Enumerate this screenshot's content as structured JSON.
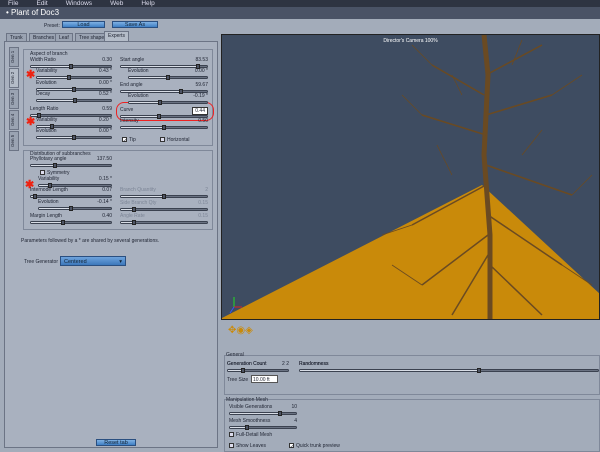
{
  "menu": [
    "File",
    "Edit",
    "Windows",
    "Web",
    "Help"
  ],
  "window_title": "Plant of Doc3",
  "preset": {
    "label": "Preset:",
    "load": "Load",
    "save_as": "Save As"
  },
  "tabs": [
    {
      "label": "Trunk"
    },
    {
      "label": "Branches"
    },
    {
      "label": "Leaf"
    },
    {
      "label": "Tree shape"
    },
    {
      "label": "Experts",
      "active": true
    }
  ],
  "generation_tabs": [
    "Gen 1",
    "Gen 2",
    "Gen 3",
    "Gen 4",
    "Gen 5"
  ],
  "aspect": {
    "title": "Aspect of branch",
    "left": [
      {
        "label": "Width Ratio",
        "value": "0.30",
        "fraction": 0.5
      },
      {
        "label": "Variability",
        "value": "0.43 *",
        "fraction": 0.43,
        "indent": true
      },
      {
        "label": "Evolution",
        "value": "0.00 *",
        "fraction": 0.5,
        "indent": true
      },
      {
        "label": "Decay",
        "value": "0.52 *",
        "fraction": 0.52,
        "indent": true
      },
      {
        "label": "Length Ratio",
        "value": "0.59",
        "fraction": 0.1
      },
      {
        "label": "Variability",
        "value": "0.20 *",
        "fraction": 0.2,
        "indent": true
      },
      {
        "label": "Evolution",
        "value": "0.00 *",
        "fraction": 0.5,
        "indent": true
      }
    ],
    "right": [
      {
        "label": "Start angle",
        "value": "83.53",
        "fraction": 0.9
      },
      {
        "label": "Evolution",
        "value": "0.00 *",
        "fraction": 0.5,
        "indent": true
      },
      {
        "label": "End angle",
        "value": "59.67",
        "fraction": 0.7
      },
      {
        "label": "Evolution",
        "value": "-0.19 *",
        "fraction": 0.4,
        "indent": true
      },
      {
        "label": "Curve",
        "value": "0.44",
        "fraction": 0.44,
        "highlight": true
      },
      {
        "label": "Intensity",
        "value": "0.50",
        "fraction": 0.5
      }
    ],
    "tip": "Tip",
    "horizontal": "Horizontal"
  },
  "distribution": {
    "title": "Distribution of subbranches",
    "phyllotaxy": {
      "label": "Phyllotaxy angle",
      "value": "137.50",
      "fraction": 0.3
    },
    "symmetry": "Symmetry",
    "variability": {
      "label": "Variability",
      "value": "0.15 *",
      "fraction": 0.15
    },
    "internode": {
      "label": "Internode Length",
      "value": "0.07",
      "fraction": 0.05
    },
    "evolution": {
      "label": "Evolution",
      "value": "-0.14 *",
      "fraction": 0.45
    },
    "margin": {
      "label": "Margin Length",
      "value": "0.40",
      "fraction": 0.4
    },
    "branch_quantity": {
      "label": "Branch Quantity",
      "value": "2",
      "fraction": 0.5
    },
    "side_branch": {
      "label": "Side Branch Qty",
      "value": "0.15",
      "fraction": 0.15
    },
    "angle_rate": {
      "label": "Angle Rate",
      "value": "0.15",
      "fraction": 0.15
    }
  },
  "note": "Parameters followed by a * are shared by several generations.",
  "tree_generator": {
    "label": "Tree Generator",
    "value": "Centered"
  },
  "reset_tab": "Reset tab",
  "viewport": {
    "camera": "Director's Camera 100%",
    "sky": "#3e4c61",
    "ground": "#c98a0a"
  },
  "general": {
    "title": "General",
    "generation_count": {
      "label": "Generation Count",
      "value": "2",
      "fraction": 0.25
    },
    "randomness": {
      "label": "Randomness",
      "fraction": 0.6
    },
    "tree_size": {
      "label": "Tree Size",
      "value": "10.00 ft"
    }
  },
  "mesh": {
    "title": "Manipulation Mesh",
    "visible_generations": {
      "label": "Visible Generations",
      "value": "10",
      "fraction": 0.75
    },
    "mesh_smoothness": {
      "label": "Mesh Smoothness",
      "value": "4",
      "fraction": 0.25
    },
    "full_detail": "Full-Detail Mesh",
    "show_leaves": "Show Leaves",
    "quick_trunk": "Quick trunk preview"
  }
}
